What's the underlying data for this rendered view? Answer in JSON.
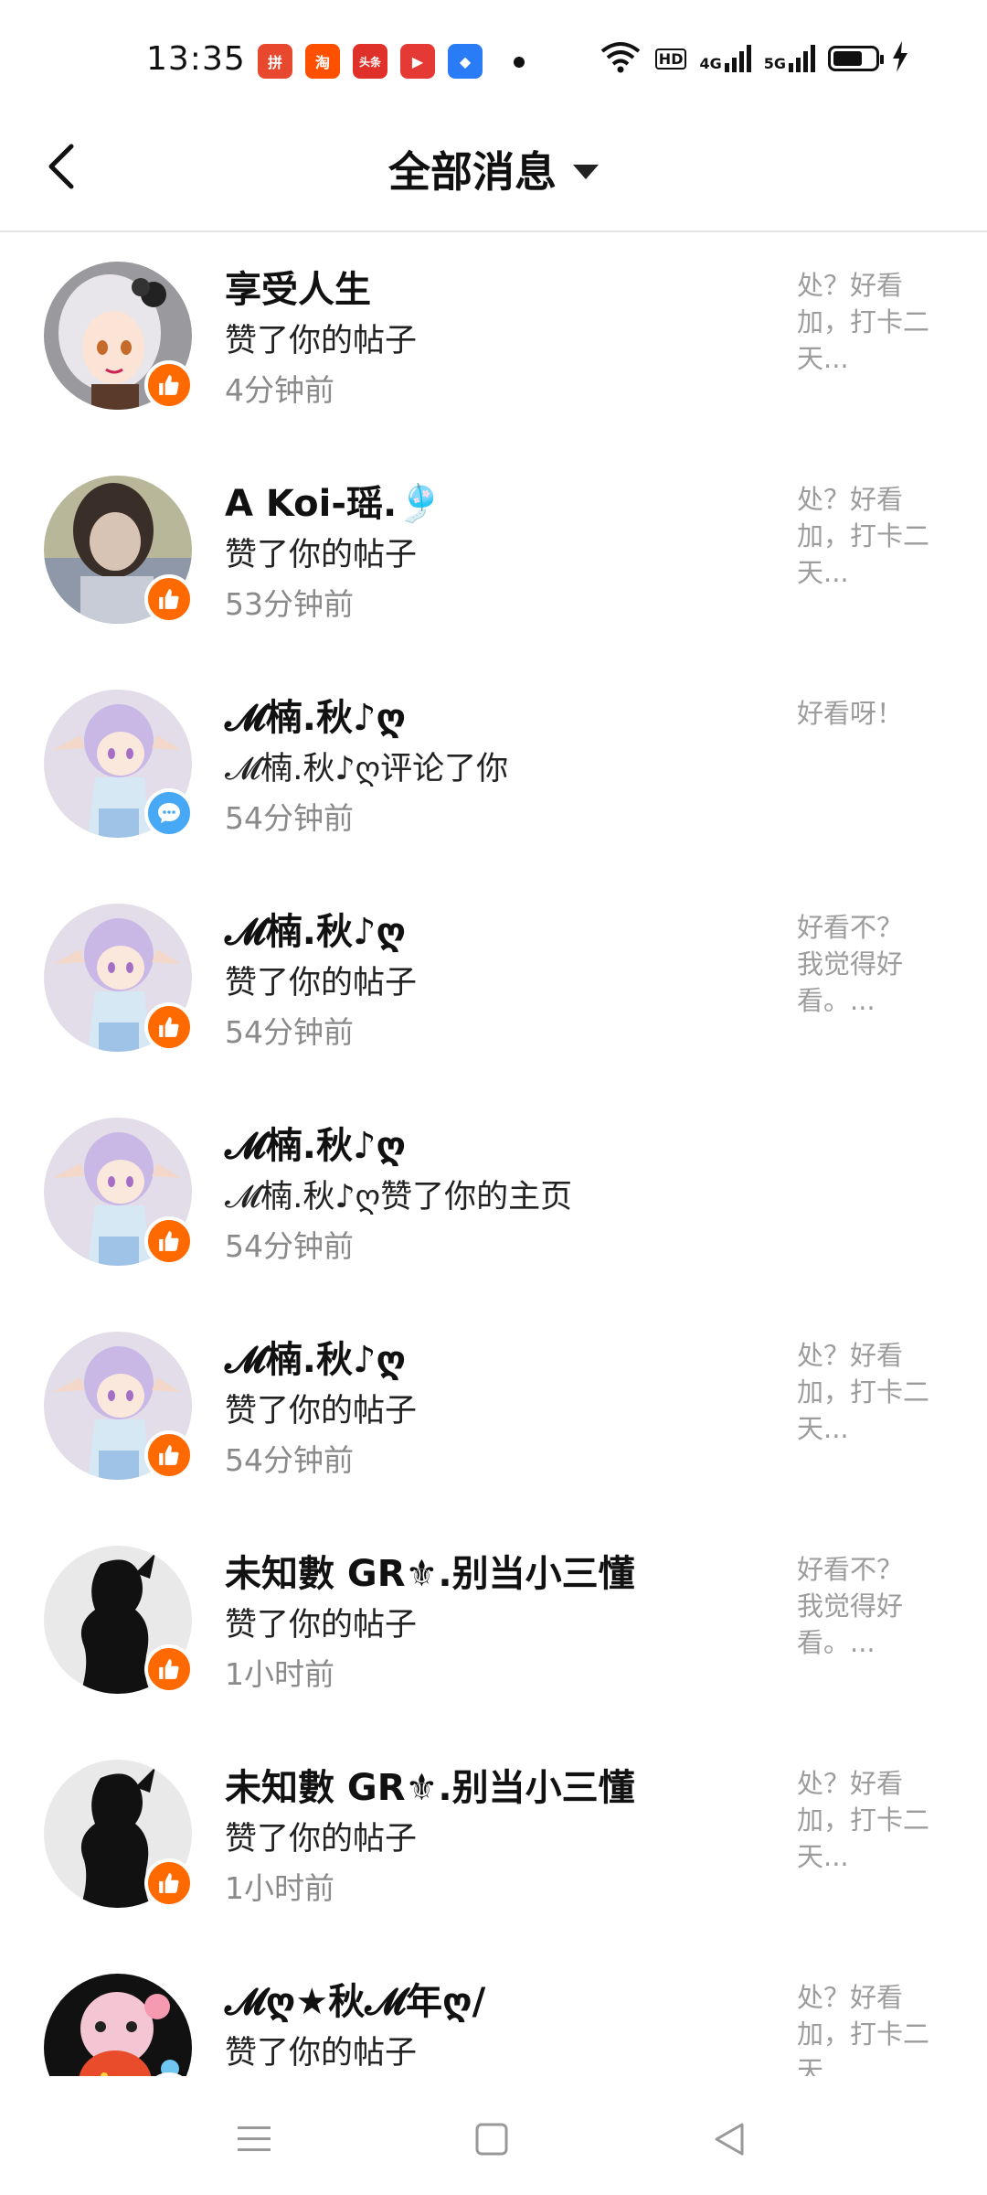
{
  "status_bar": {
    "time": "13:35",
    "apps": [
      {
        "name": "pinduoduo-icon",
        "color": "#e8492e",
        "glyph": "拼"
      },
      {
        "name": "taobao-icon",
        "color": "#ff5000",
        "glyph": "淘"
      },
      {
        "name": "toutiao-icon",
        "color": "#e0302a",
        "glyph": "头条"
      },
      {
        "name": "video-app-icon",
        "color": "#e53935",
        "glyph": "▶"
      },
      {
        "name": "blue-app-icon",
        "color": "#2a7bf6",
        "glyph": "◆"
      }
    ],
    "network_hd": "HD",
    "network_4g": "4G",
    "network_5g": "5G",
    "battery_level": 0.7
  },
  "header": {
    "title": "全部消息"
  },
  "messages": [
    {
      "name": "享受人生",
      "action": "赞了你的帖子",
      "time": "4分钟前",
      "preview": "处？好看\n加，打卡二\n天...",
      "type": "like",
      "avatar": "anime-girl-1"
    },
    {
      "name": "A Koi-瑶.🎐",
      "action": "赞了你的帖子",
      "time": "53分钟前",
      "preview": "处？好看\n加，打卡二\n天...",
      "type": "like",
      "avatar": "photo-girl"
    },
    {
      "name": "𝓜楠.秋♪ღ",
      "action": "𝓜楠.秋♪ღ评论了你",
      "time": "54分钟前",
      "preview": "好看呀！",
      "type": "comment",
      "avatar": "anime-elf"
    },
    {
      "name": "𝓜楠.秋♪ღ",
      "action": "赞了你的帖子",
      "time": "54分钟前",
      "preview": "好看不？\n我觉得好\n看。...",
      "type": "like",
      "avatar": "anime-elf"
    },
    {
      "name": "𝓜楠.秋♪ღ",
      "action": "𝓜楠.秋♪ღ赞了你的主页",
      "time": "54分钟前",
      "preview": "",
      "type": "like",
      "avatar": "anime-elf"
    },
    {
      "name": "𝓜楠.秋♪ღ",
      "action": "赞了你的帖子",
      "time": "54分钟前",
      "preview": "处？好看\n加，打卡二\n天...",
      "type": "like",
      "avatar": "anime-elf"
    },
    {
      "name": "未知數 GR⚜.别当小三懂",
      "action": "赞了你的帖子",
      "time": "1小时前",
      "preview": "好看不？\n我觉得好\n看。...",
      "type": "like",
      "avatar": "silhouette"
    },
    {
      "name": "未知數 GR⚜.别当小三懂",
      "action": "赞了你的帖子",
      "time": "1小时前",
      "preview": "处？好看\n加，打卡二\n天...",
      "type": "like",
      "avatar": "silhouette"
    },
    {
      "name": "𝓜ღ★秋𝓜年ღ/",
      "action": "赞了你的帖子",
      "time": "",
      "preview": "处？好看\n加，打卡二\n天",
      "type": "like",
      "avatar": "colorful-cartoon"
    }
  ]
}
